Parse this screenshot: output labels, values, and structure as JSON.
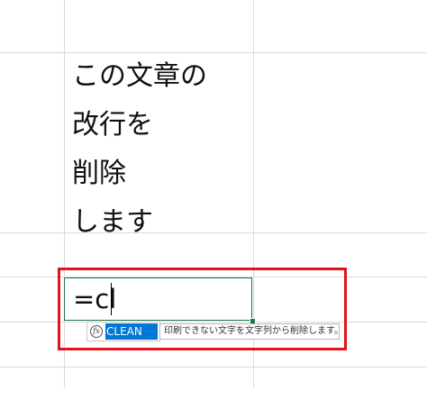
{
  "cell": {
    "lines": [
      "この文章の",
      "改行を",
      "削除",
      "します"
    ]
  },
  "editor": {
    "formula_input": "=cl"
  },
  "autocomplete": {
    "function_name": "CLEAN",
    "icon": "function-icon",
    "tooltip": "印刷できない文字を文字列から削除します。"
  },
  "colors": {
    "highlight_border": "#e0141e",
    "active_cell_border": "#217346",
    "suggestion_background": "#0078d7",
    "gridline": "#d9d9d9"
  }
}
